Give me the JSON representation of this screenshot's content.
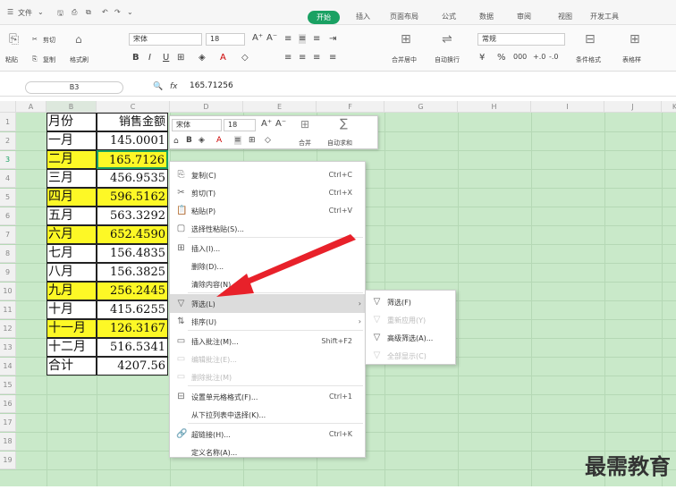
{
  "menubar": {
    "file": "文件",
    "tabs": [
      "开始",
      "插入",
      "页面布局",
      "公式",
      "数据",
      "审阅",
      "视图",
      "开发工具"
    ]
  },
  "ribbon": {
    "cut": "剪切",
    "paste": "粘贴",
    "copy": "复制",
    "format_painter": "格式刷",
    "font_name": "宋体",
    "font_size": "18",
    "merge_center": "合并居中",
    "wrap": "自动换行",
    "number_format": "常规",
    "cond_format": "条件格式",
    "table_style": "表格样"
  },
  "formula_bar": {
    "cell_ref": "B3",
    "fx": "fx",
    "value": "165.71256"
  },
  "grid": {
    "columns": [
      "A",
      "B",
      "C",
      "D",
      "E",
      "F",
      "G",
      "H",
      "I",
      "J",
      "K"
    ],
    "rows": [
      "1",
      "2",
      "3",
      "4",
      "5",
      "6",
      "7",
      "8",
      "9",
      "10",
      "11",
      "12",
      "13",
      "14",
      "15",
      "16",
      "17",
      "18",
      "19"
    ],
    "col_a": [
      "月份",
      "一月",
      "二月",
      "三月",
      "四月",
      "五月",
      "六月",
      "七月",
      "八月",
      "九月",
      "十月",
      "十一月",
      "十二月",
      "合计"
    ],
    "col_b": [
      "销售金额",
      "145.0001",
      "165.7126",
      "456.9535",
      "596.5162",
      "563.3292",
      "652.4590",
      "156.4835",
      "156.3825",
      "256.2445",
      "415.6255",
      "126.3167",
      "516.5341",
      "4207.56"
    ]
  },
  "mini_toolbar": {
    "font": "宋体",
    "size": "18",
    "bold": "B",
    "merge": "合并",
    "autosum": "自动求和"
  },
  "context_menu": [
    {
      "label": "复制(C)",
      "shortcut": "Ctrl+C",
      "icon": "copy-icon",
      "ch": "⎘"
    },
    {
      "label": "剪切(T)",
      "shortcut": "Ctrl+X",
      "icon": "scissors-icon",
      "ch": "✂"
    },
    {
      "label": "粘贴(P)",
      "shortcut": "Ctrl+V",
      "icon": "paste-icon",
      "ch": "📋"
    },
    {
      "label": "选择性粘贴(S)...",
      "shortcut": "",
      "icon": "paste-special-icon",
      "ch": "▢"
    },
    {
      "label": "插入(I)...",
      "shortcut": "",
      "icon": "insert-icon",
      "ch": "⊞"
    },
    {
      "label": "删除(D)...",
      "shortcut": "",
      "icon": "",
      "ch": ""
    },
    {
      "label": "清除内容(N)",
      "shortcut": "",
      "icon": "",
      "ch": ""
    },
    {
      "label": "筛选(L)",
      "shortcut": "",
      "icon": "filter-icon",
      "ch": "▽"
    },
    {
      "label": "排序(U)",
      "shortcut": "",
      "icon": "sort-icon",
      "ch": "⇅"
    },
    {
      "label": "插入批注(M)...",
      "shortcut": "Shift+F2",
      "icon": "comment-icon",
      "ch": "▭"
    },
    {
      "label": "编辑批注(E)...",
      "shortcut": "",
      "icon": "edit-comment-icon",
      "ch": "▭"
    },
    {
      "label": "删除批注(M)",
      "shortcut": "",
      "icon": "delete-comment-icon",
      "ch": "▭"
    },
    {
      "label": "设置单元格格式(F)...",
      "shortcut": "Ctrl+1",
      "icon": "format-cells-icon",
      "ch": "⊟"
    },
    {
      "label": "从下拉列表中选择(K)...",
      "shortcut": "",
      "icon": "",
      "ch": ""
    },
    {
      "label": "超链接(H)...",
      "shortcut": "Ctrl+K",
      "icon": "link-icon",
      "ch": "🔗"
    },
    {
      "label": "定义名称(A)...",
      "shortcut": "",
      "icon": "",
      "ch": ""
    }
  ],
  "submenu": [
    {
      "label": "筛选(F)",
      "icon": "filter-icon",
      "ch": "▽",
      "disabled": false
    },
    {
      "label": "重新应用(Y)",
      "icon": "reapply-filter-icon",
      "ch": "▽",
      "disabled": true
    },
    {
      "label": "高级筛选(A)...",
      "icon": "advanced-filter-icon",
      "ch": "▽",
      "disabled": false
    },
    {
      "label": "全部显示(C)",
      "icon": "show-all-icon",
      "ch": "▽",
      "disabled": true
    }
  ],
  "watermark": "最需教育",
  "colors": {
    "accent": "#1aa163",
    "highlight": "#fdf826",
    "grid": "#c9e9c9",
    "arrow": "#e8212a"
  }
}
